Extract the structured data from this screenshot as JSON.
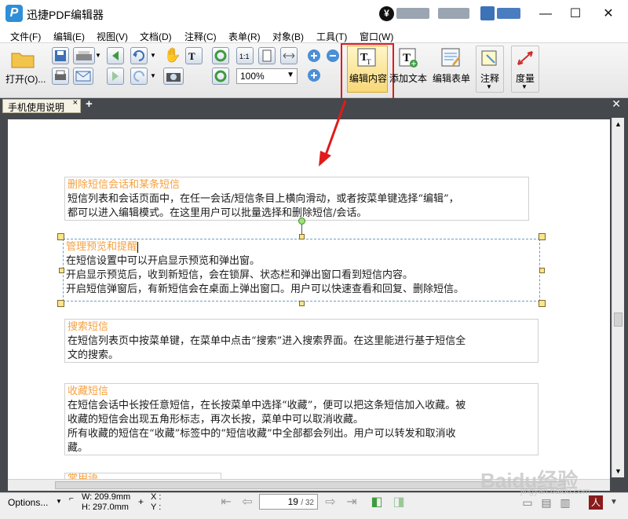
{
  "title_bar": {
    "app_title": "迅捷PDF编辑器",
    "logo_letter": "P",
    "coin_symbol": "¥",
    "minimize": "—",
    "maximize": "☐",
    "close": "✕"
  },
  "menu": {
    "items": [
      "文件(F)",
      "编辑(E)",
      "视图(V)",
      "文档(D)",
      "注释(C)",
      "表单(R)",
      "对象(B)",
      "工具(T)",
      "窗口(W)"
    ]
  },
  "toolbar": {
    "open_label": "打开(O)...",
    "zoom_value": "100%",
    "edit_content_label": "编辑内容",
    "add_text_label": "添加文本",
    "edit_form_label": "编辑表单",
    "annotate_label": "注释",
    "measure_label": "度量"
  },
  "tabs": {
    "active_tab": "手机使用说明",
    "tab_close": "×",
    "add": "+",
    "close_all": "✕"
  },
  "document": {
    "blocks": [
      {
        "heading": "删除短信会话和某条短信",
        "lines": [
          "短信列表和会话页面中，在任一会话/短信条目上横向滑动，或者按菜单键选择“编辑”，",
          "都可以进入编辑模式。在这里用户可以批量选择和删除短信/会话。"
        ]
      },
      {
        "heading": "管理预览和提醒",
        "lines": [
          "在短信设置中可以开启显示预览和弹出窗。",
          "开启显示预览后，收到新短信，会在锁屏、状态栏和弹出窗口看到短信内容。",
          "开启短信弹窗后，有新短信会在桌面上弹出窗口。用户可以快速查看和回复、删除短信。"
        ]
      },
      {
        "heading": "搜索短信",
        "lines": [
          "在短信列表页中按菜单键，在菜单中点击“搜索”进入搜索界面。在这里能进行基于短信全",
          "文的搜索。"
        ]
      },
      {
        "heading": "收藏短信",
        "lines": [
          "在短信会话中长按任意短信，在长按菜单中选择“收藏”，便可以把这条短信加入收藏。被",
          "收藏的短信会出现五角形标志，再次长按，菜单中可以取消收藏。",
          "所有收藏的短信在“收藏”标签中的“短信收藏”中全部都会列出。用户可以转发和取消收",
          "藏。"
        ]
      },
      {
        "heading": "常用语",
        "lines": []
      }
    ]
  },
  "status_bar": {
    "options_label": "Options...",
    "width_label": "W: 209.9mm",
    "height_label": "H: 297.0mm",
    "x_label": "X :",
    "y_label": "Y :",
    "page_current": "19",
    "page_total": "/ 32"
  },
  "watermark": {
    "text": "Baidu经验",
    "subtext": "jingyan.baidu.com"
  },
  "colors": {
    "highlight_red": "#e01b1b",
    "heading_orange": "#f5a142",
    "tab_strip": "#45484d",
    "selection_handle": "#ffe48a"
  }
}
